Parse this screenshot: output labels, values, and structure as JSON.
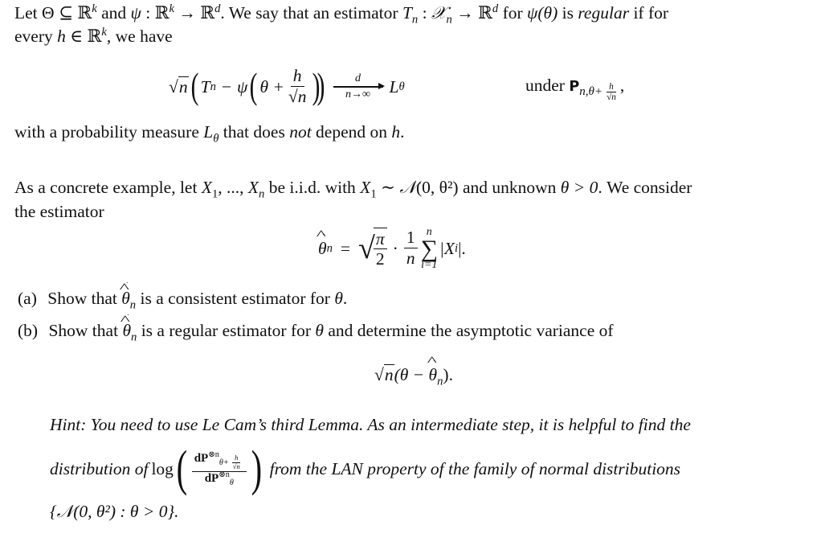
{
  "definition": {
    "line1_prefix": "Let",
    "Theta": "Θ",
    "subseteq": "⊆",
    "R": "ℝ",
    "k": "k",
    "and": "and",
    "psi": "ψ",
    "colon": ":",
    "to": "→",
    "d": "d",
    "line1_mid": ". We say that an estimator",
    "T": "T",
    "n": "n",
    "Xcal": "𝒳",
    "for": "for",
    "psi_theta": "ψ(θ)",
    "is": "is",
    "regular": "regular",
    "if_for": "if for",
    "line2_prefix": "every",
    "h": "h",
    "in": "∈",
    "line2_suffix": ", we have"
  },
  "display1": {
    "sqrt_n": "n",
    "T": "T",
    "n": "n",
    "minus": "−",
    "psi": "ψ",
    "theta_plus": "θ +",
    "h": "h",
    "arrow_top": "d",
    "arrow_bottom": "n→∞",
    "L": "L",
    "theta": "θ",
    "under": "under",
    "P": "P",
    "under_sub": "n,θ+",
    "comma": ","
  },
  "after_display": {
    "prefix": "with a probability measure",
    "L": "L",
    "theta": "θ",
    "mid": "that does",
    "not": "not",
    "suffix": "depend on",
    "h": "h",
    "end": "."
  },
  "example": {
    "line1_prefix": "As a concrete example, let",
    "X": "X",
    "one": "1",
    "dots": ", ..., ",
    "n": "n",
    "iid": "be i.i.d. with",
    "sim": "∼",
    "N": "𝒩",
    "normal_args": "(0, θ²)",
    "unknown": "and unknown",
    "theta_gt": "θ > 0",
    "consider": ". We consider",
    "line2": "the estimator"
  },
  "estimator": {
    "theta": "θ",
    "n": "n",
    "eq": "=",
    "pi": "π",
    "two": "2",
    "cdot": "·",
    "one": "1",
    "sum_symbol": "∑",
    "sum_top": "n",
    "sum_bottom": "i=1",
    "abs_term": "|X",
    "i": "i",
    "abs_end": "|."
  },
  "items": [
    {
      "label": "(a)",
      "prefix": "Show that",
      "suffix": "is a consistent estimator for",
      "theta": "θ",
      "end": "."
    },
    {
      "label": "(b)",
      "prefix": "Show that",
      "suffix": "is a regular estimator for",
      "theta": "θ",
      "rest": "and determine the asymptotic variance of"
    }
  ],
  "display2": {
    "sqrt_n": "n",
    "open": "(θ − ",
    "theta": "θ",
    "n": "n",
    "close": ")."
  },
  "hint": {
    "line1": "Hint: You need to use Le Cam’s third Lemma. As an intermediate step, it is helpful to find the",
    "distribution_of": "distribution of",
    "log": "log",
    "dP": "dP",
    "otimes_n": "⊗n",
    "num_sub": "θ+",
    "den_sub": "θ",
    "after_log": "from the LAN property of the family of normal distributions",
    "family": "{𝒩(0, θ²) : θ > 0}."
  }
}
